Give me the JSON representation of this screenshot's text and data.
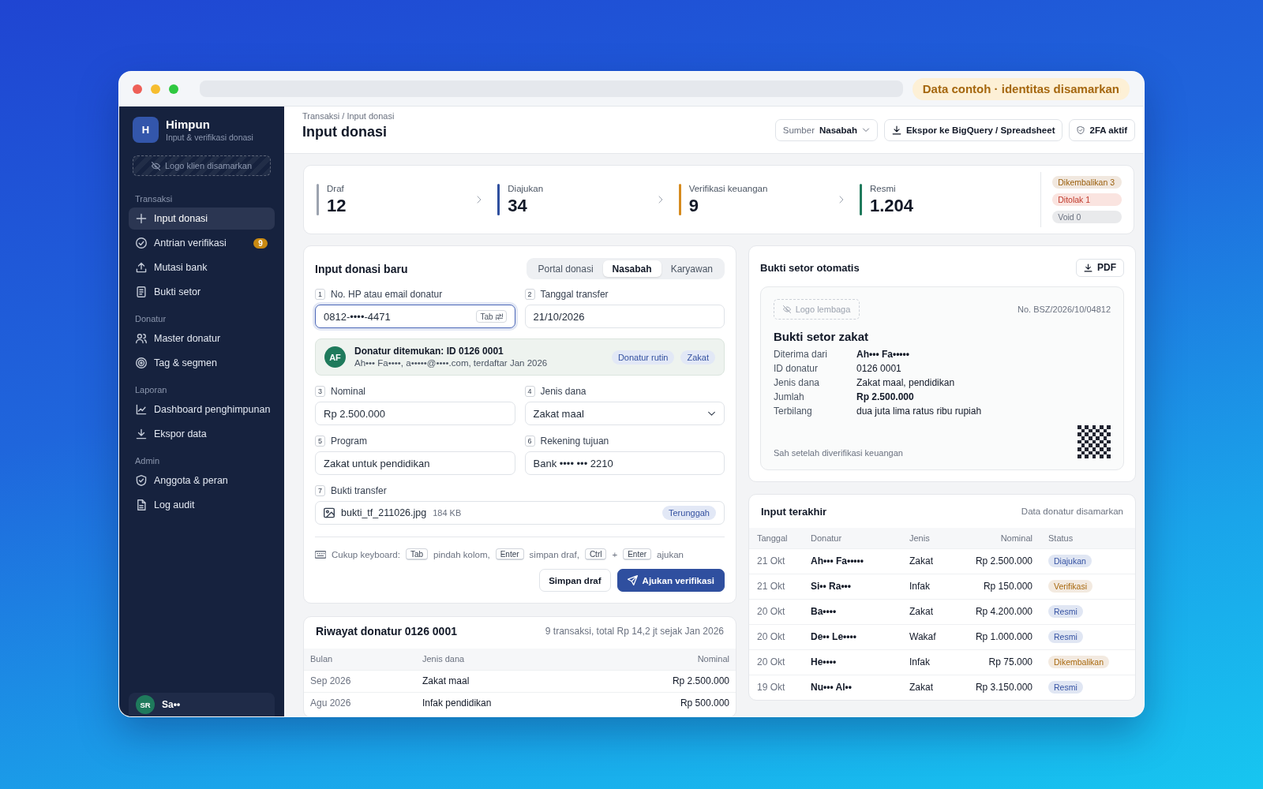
{
  "browser": {
    "notice": "Data contoh · identitas disamarkan"
  },
  "sidebar": {
    "logo_letter": "H",
    "app_name": "Himpun",
    "app_tagline": "Input & verifikasi donasi",
    "client_logo": "Logo klien disamarkan",
    "sections": [
      {
        "title": "Transaksi",
        "items": [
          {
            "label": "Input donasi",
            "selected": true
          },
          {
            "label": "Antrian verifikasi",
            "selected": false,
            "badge": "9"
          },
          {
            "label": "Mutasi bank",
            "selected": false
          },
          {
            "label": "Bukti setor",
            "selected": false
          }
        ]
      },
      {
        "title": "Donatur",
        "items": [
          {
            "label": "Master donatur",
            "selected": false
          },
          {
            "label": "Tag & segmen",
            "selected": false
          }
        ]
      },
      {
        "title": "Laporan",
        "items": [
          {
            "label": "Dashboard penghimpunan",
            "selected": false
          },
          {
            "label": "Ekspor data",
            "selected": false
          }
        ]
      },
      {
        "title": "Admin",
        "items": [
          {
            "label": "Anggota & peran",
            "selected": false
          },
          {
            "label": "Log audit",
            "selected": false
          }
        ]
      }
    ],
    "user": {
      "initials": "SR",
      "name": "Sa••"
    }
  },
  "header": {
    "breadcrumb": "Transaksi / Input donasi",
    "title": "Input donasi",
    "source": {
      "label": "Sumber",
      "value": "Nasabah"
    },
    "export_button": "Ekspor ke BigQuery / Spreadsheet",
    "security_badge": "2FA aktif"
  },
  "stats": {
    "stages": [
      {
        "label": "Draf",
        "value": "12",
        "color": "#9ca3af"
      },
      {
        "label": "Diajukan",
        "value": "34",
        "color": "#2f4f9e"
      },
      {
        "label": "Verifikasi keuangan",
        "value": "9",
        "color": "#d68b1e"
      },
      {
        "label": "Resmi",
        "value": "1.204",
        "color": "#1f7a5c"
      }
    ],
    "exceptions": [
      {
        "label": "Dikembalikan 3",
        "color": "#9a5f0c"
      },
      {
        "label": "Ditolak 1",
        "color": "#c0392b"
      },
      {
        "label": "Void 0",
        "color": "#6b7280"
      }
    ]
  },
  "form": {
    "title": "Input donasi baru",
    "tabs": [
      {
        "label": "Portal donasi",
        "selected": false
      },
      {
        "label": "Nasabah",
        "selected": true
      },
      {
        "label": "Karyawan",
        "selected": false
      }
    ],
    "fields": [
      {
        "kind": "text",
        "number": "1",
        "label": "No. HP atau email donatur",
        "value": "0812-••••-4471",
        "focused": true,
        "key_hint": "Tab"
      },
      {
        "kind": "text",
        "number": "2",
        "label": "Tanggal transfer",
        "value": "21/10/2026",
        "focused": false
      },
      {
        "kind": "match",
        "initials": "AF",
        "title": "Donatur ditemukan: ID 0126 0001",
        "detail": "Ah••• Fa••••, a•••••@••••.com, terdaftar Jan 2026",
        "tags": [
          "Donatur rutin",
          "Zakat"
        ]
      },
      {
        "kind": "text",
        "number": "3",
        "label": "Nominal",
        "value": "Rp 2.500.000",
        "focused": false
      },
      {
        "kind": "select",
        "number": "4",
        "label": "Jenis dana",
        "value": "Zakat maal",
        "focused": false
      },
      {
        "kind": "text",
        "number": "5",
        "label": "Program",
        "value": "Zakat untuk pendidikan",
        "focused": false
      },
      {
        "kind": "text",
        "number": "6",
        "label": "Rekening tujuan",
        "value": "Bank •••• ••• 2210",
        "focused": false
      },
      {
        "kind": "file",
        "number": "7",
        "label": "Bukti transfer",
        "file_name": "bukti_tf_211026.jpg",
        "size": "184 KB",
        "status": "Terunggah",
        "focused": false
      }
    ],
    "keyboard_hint": {
      "label": "Cukup keyboard:",
      "parts": [
        {
          "kind": "key",
          "text": "Tab"
        },
        {
          "kind": "text",
          "text": "pindah kolom,"
        },
        {
          "kind": "key",
          "text": "Enter"
        },
        {
          "kind": "text",
          "text": "simpan draf,"
        },
        {
          "kind": "key",
          "text": "Ctrl"
        },
        {
          "kind": "text",
          "text": "+"
        },
        {
          "kind": "key",
          "text": "Enter"
        },
        {
          "kind": "text",
          "text": "ajukan"
        }
      ]
    },
    "buttons": [
      {
        "kind": "secondary",
        "label": "Simpan draf"
      },
      {
        "kind": "primary",
        "label": "Ajukan verifikasi"
      }
    ]
  },
  "history": {
    "title": "Riwayat donatur 0126 0001",
    "summary": "9 transaksi, total Rp 14,2 jt sejak Jan 2026",
    "columns": [
      "Bulan",
      "Jenis dana",
      "Nominal"
    ],
    "rows": [
      {
        "month": "Sep 2026",
        "fund": "Zakat maal",
        "amount": "Rp 2.500.000"
      },
      {
        "month": "Agu 2026",
        "fund": "Infak pendidikan",
        "amount": "Rp 500.000"
      }
    ]
  },
  "receipt": {
    "title": "Bukti setor otomatis",
    "pdf_button": "PDF",
    "logo_placeholder": "Logo lembaga",
    "number": "No. BSZ/2026/10/04812",
    "heading": "Bukti setor zakat",
    "rows": [
      {
        "label": "Diterima dari",
        "value": "Ah••• Fa•••••",
        "strong": true
      },
      {
        "label": "ID donatur",
        "value": "0126 0001",
        "strong": false
      },
      {
        "label": "Jenis dana",
        "value": "Zakat maal, pendidikan",
        "strong": false
      },
      {
        "label": "Jumlah",
        "value": "Rp 2.500.000",
        "strong": true
      },
      {
        "label": "Terbilang",
        "value": "dua juta lima ratus ribu rupiah",
        "strong": false
      }
    ],
    "footer": "Sah setelah diverifikasi keuangan"
  },
  "recent": {
    "title": "Input terakhir",
    "note": "Data donatur disamarkan",
    "columns": [
      "Tanggal",
      "Donatur",
      "Jenis",
      "Nominal",
      "Status"
    ],
    "rows": [
      {
        "date": "21 Okt",
        "donor": "Ah••• Fa•••••",
        "type": "Zakat",
        "amount": "Rp 2.500.000",
        "status": {
          "label": "Diajukan",
          "color": "#3653a3"
        }
      },
      {
        "date": "21 Okt",
        "donor": "Si•• Ra•••",
        "type": "Infak",
        "amount": "Rp 150.000",
        "status": {
          "label": "Verifikasi",
          "color": "#a8690f"
        }
      },
      {
        "date": "20 Okt",
        "donor": "Ba••••",
        "type": "Zakat",
        "amount": "Rp 4.200.000",
        "status": {
          "label": "Resmi",
          "color": "#3653a3"
        }
      },
      {
        "date": "20 Okt",
        "donor": "De•• Le••••",
        "type": "Wakaf",
        "amount": "Rp 1.000.000",
        "status": {
          "label": "Resmi",
          "color": "#3653a3"
        }
      },
      {
        "date": "20 Okt",
        "donor": "He••••",
        "type": "Infak",
        "amount": "Rp 75.000",
        "status": {
          "label": "Dikembalikan",
          "color": "#a8690f"
        }
      },
      {
        "date": "19 Okt",
        "donor": "Nu••• Al••",
        "type": "Zakat",
        "amount": "Rp 3.150.000",
        "status": {
          "label": "Resmi",
          "color": "#3653a3"
        }
      }
    ]
  }
}
